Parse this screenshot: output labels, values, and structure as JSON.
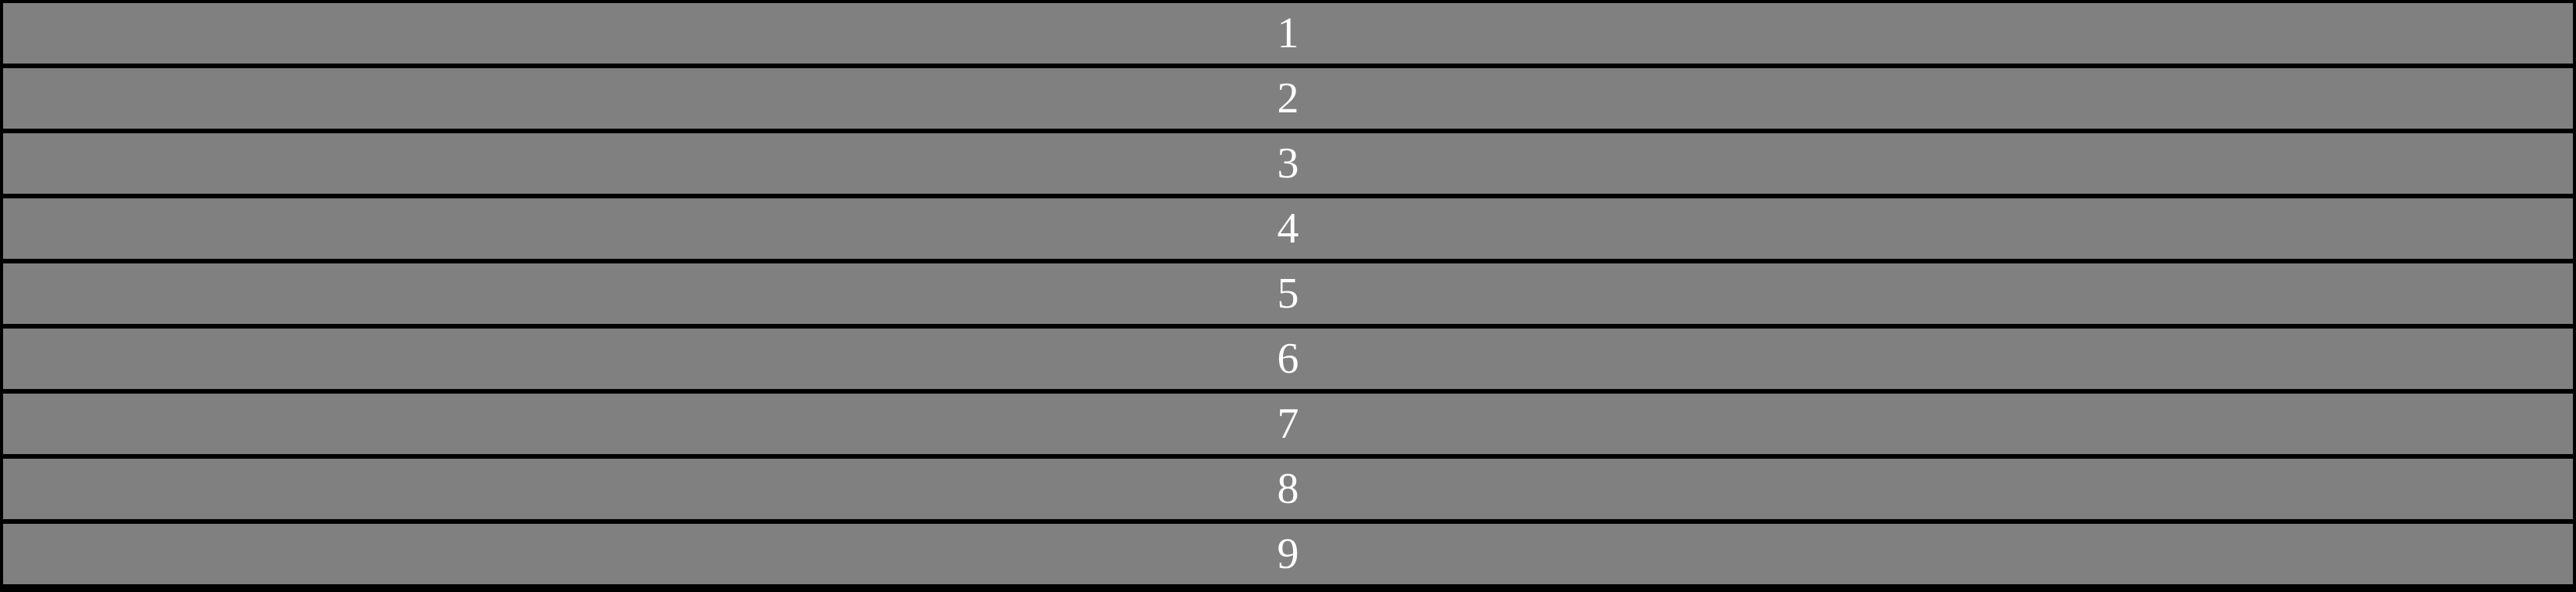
{
  "colors": {
    "background": "#000000",
    "item_fill": "#808080",
    "item_text": "#ffffff"
  },
  "items": [
    {
      "label": "1"
    },
    {
      "label": "2"
    },
    {
      "label": "3"
    },
    {
      "label": "4"
    },
    {
      "label": "5"
    },
    {
      "label": "6"
    },
    {
      "label": "7"
    },
    {
      "label": "8"
    },
    {
      "label": "9"
    }
  ]
}
